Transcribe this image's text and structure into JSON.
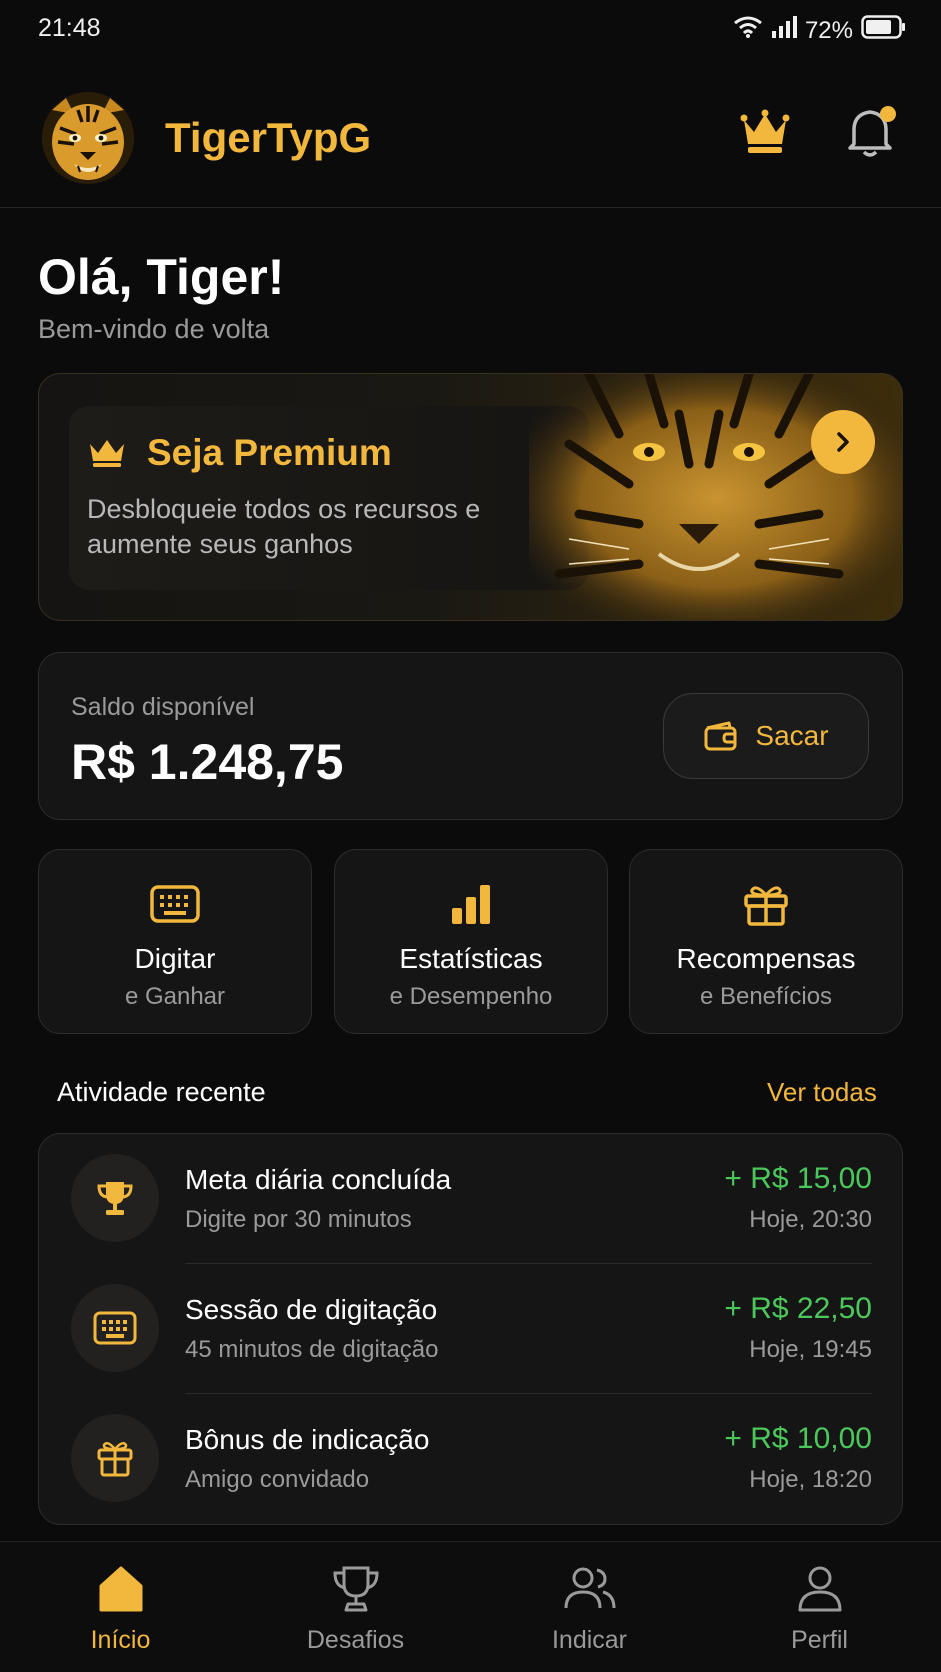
{
  "status_bar": {
    "time": "21:48",
    "battery": "72%"
  },
  "header": {
    "brand": "TigerTypG",
    "logo_icon": "tiger-logo",
    "crown_icon": "crown-icon",
    "bell_icon": "bell-icon"
  },
  "greeting": {
    "title": "Olá, Tiger!",
    "subtitle": "Bem-vindo de volta"
  },
  "premium": {
    "title": "Seja Premium",
    "description": "Desbloqueie todos os recursos e aumente seus ganhos"
  },
  "balance": {
    "label": "Saldo disponível",
    "value": "R$ 1.248,75",
    "withdraw_label": "Sacar"
  },
  "features": [
    {
      "title": "Digitar",
      "subtitle": "e Ganhar",
      "icon": "keyboard-icon"
    },
    {
      "title": "Estatísticas",
      "subtitle": "e Desempenho",
      "icon": "bar-chart-icon"
    },
    {
      "title": "Recompensas",
      "subtitle": "e Benefícios",
      "icon": "gift-icon"
    }
  ],
  "activity": {
    "title": "Atividade recente",
    "link": "Ver todas",
    "items": [
      {
        "title": "Meta diária concluída",
        "subtitle": "Digite por 30 minutos",
        "amount": "+ R$ 15,00",
        "time": "Hoje, 20:30",
        "icon": "trophy-icon"
      },
      {
        "title": "Sessão de digitação",
        "subtitle": "45 minutos de digitação",
        "amount": "+ R$ 22,50",
        "time": "Hoje, 19:45",
        "icon": "keyboard-icon"
      },
      {
        "title": "Bônus de indicação",
        "subtitle": "Amigo convidado",
        "amount": "+ R$ 10,00",
        "time": "Hoje, 18:20",
        "icon": "gift-icon"
      }
    ]
  },
  "nav": [
    {
      "label": "Início",
      "icon": "home-icon",
      "active": true
    },
    {
      "label": "Desafios",
      "icon": "trophy-icon",
      "active": false
    },
    {
      "label": "Indicar",
      "icon": "users-icon",
      "active": false
    },
    {
      "label": "Perfil",
      "icon": "user-icon",
      "active": false
    }
  ],
  "colors": {
    "accent": "#f2b73d",
    "positive": "#4cc75c",
    "background": "#0b0b0b",
    "card": "#151515"
  }
}
